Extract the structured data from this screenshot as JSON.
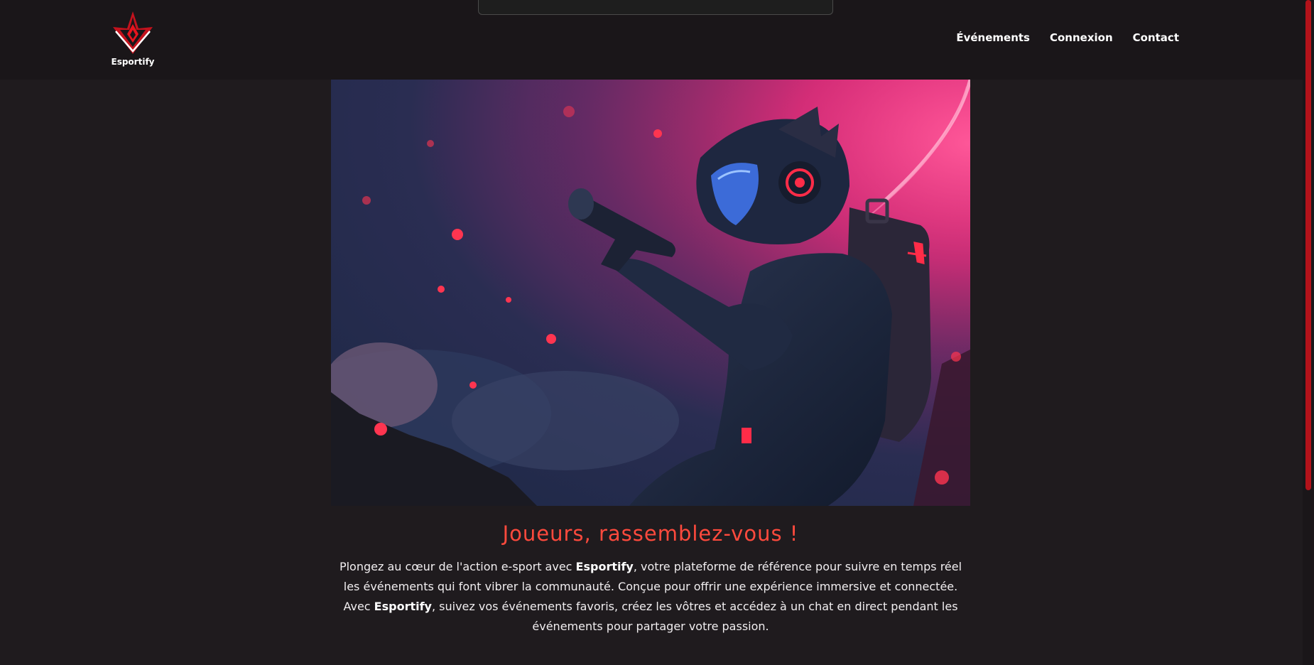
{
  "brand": {
    "name": "Esportify",
    "accent_color": "#ff4a3d",
    "logo_icon": "esportify-logo-icon"
  },
  "nav": {
    "items": [
      {
        "label": "Événements"
      },
      {
        "label": "Connexion"
      },
      {
        "label": "Contact"
      }
    ]
  },
  "hero": {
    "image_icon": "astronaut-gamer-illustration"
  },
  "content": {
    "headline": "Joueurs, rassemblez-vous !",
    "paragraph": [
      {
        "text": "Plongez au cœur de l'action e-sport avec ",
        "bold": false
      },
      {
        "text": "Esportify",
        "bold": true
      },
      {
        "text": ", votre plateforme de référence pour suivre en temps réel les événements qui font vibrer la communauté. Conçue pour offrir une expérience immersive et connectée. Avec ",
        "bold": false
      },
      {
        "text": "Esportify",
        "bold": true
      },
      {
        "text": ", suivez vos événements favoris, créez les vôtres et accédez à un chat en direct pendant les événements pour partager votre passion.",
        "bold": false
      }
    ]
  },
  "colors": {
    "background": "#1f1b1e",
    "navbar": "#1a1619",
    "scrollbar_thumb": "#b3121a"
  }
}
